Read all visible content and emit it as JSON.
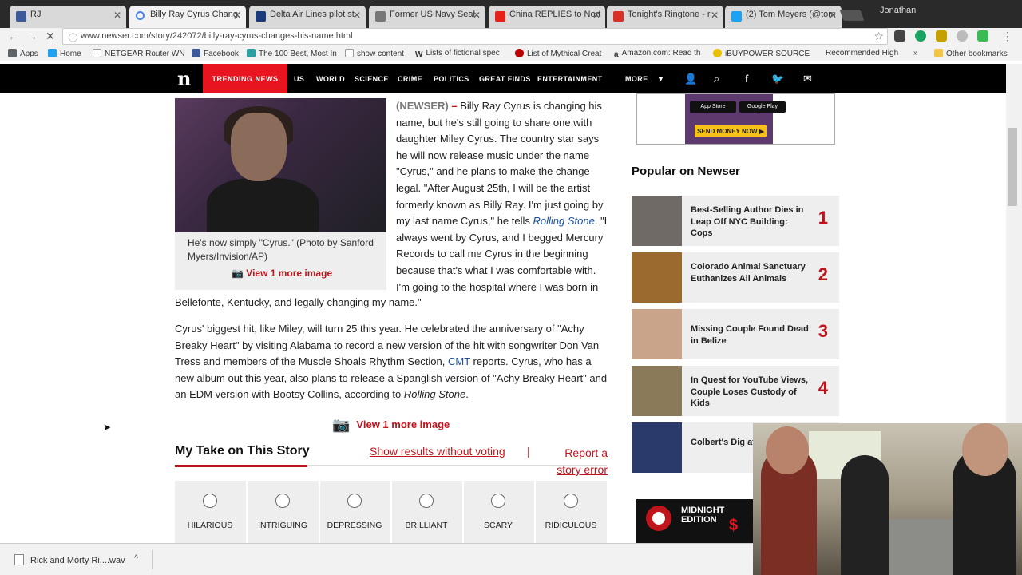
{
  "browser": {
    "tabs": [
      {
        "label": "RJ",
        "color": "#3b5998"
      },
      {
        "label": "Billy Ray Cyrus Chang",
        "color": "#4a86e8",
        "active": true
      },
      {
        "label": "Delta Air Lines pilot st",
        "color": "#1a3a7a"
      },
      {
        "label": "Former US Navy Seal ",
        "color": "#777777"
      },
      {
        "label": "China REPLIES to Nort",
        "color": "#e62117"
      },
      {
        "label": "Tonight's Ringtone - r",
        "color": "#d93025"
      },
      {
        "label": "(2) Tom Meyers (@tom",
        "color": "#1da1f2"
      }
    ],
    "user": "Jonathan",
    "url": "www.newser.com/story/242072/billy-ray-cyrus-changes-his-name.html",
    "bookmarks": [
      "Apps",
      "Home",
      "NETGEAR Router WN",
      "Facebook",
      "The 100 Best, Most In",
      "show content",
      "Lists of fictional spec",
      "List of Mythical Creat",
      "Amazon.com: Read th",
      "iBUYPOWER SOURCE",
      "Recommended High",
      "»",
      "Other bookmarks"
    ]
  },
  "site_nav": {
    "logo": "n",
    "trending": "TRENDING NEWS",
    "links": [
      "US",
      "WORLD",
      "SCIENCE",
      "CRIME",
      "POLITICS",
      "GREAT FINDS",
      "ENTERTAINMENT",
      "MORE"
    ]
  },
  "article": {
    "caption": "He's now simply \"Cyrus.\"  (Photo by Sanford Myers/Invision/AP)",
    "view_more": "View 1 more image",
    "p1_source": "(NEWSER)",
    "p1_dash": " – ",
    "p1_text_a": "Billy Ray Cyrus is changing his name, but he's still going to share one with daughter Miley Cyrus. The country star says he will now release music under the name \"Cyrus,\" and he plans to make the change legal. \"After August 25th, I will be the artist formerly known as Billy Ray. I'm just going by my last name Cyrus,\" he tells ",
    "p1_link": "Rolling Stone",
    "p1_text_b": ". \"I always went by Cyrus, and I begged Mercury Records to call me Cyrus in the beginning because that's what I was comfortable with. I'm going to the hospital where I was born in Bellefonte, Kentucky, and legally changing my name.\"",
    "p2_text_a": "Cyrus' biggest hit, like Miley, will turn 25 this year. He celebrated the anniversary of \"Achy Breaky Heart\" by visiting Alabama to record a new version of the hit with songwriter Don Van Tress and members of the Muscle Shoals Rhythm Section, ",
    "p2_link": "CMT",
    "p2_text_b": " reports. Cyrus, who has a new album out this year, also plans to release a Spanglish version of \"Achy Breaky Heart\" and an EDM version with Bootsy Collins, according to ",
    "p2_italic": "Rolling Stone",
    "p2_end": "."
  },
  "my_take": {
    "title": "My Take on This Story",
    "show_results": "Show results without voting",
    "separator": "|",
    "report": "Report a story error",
    "reactions": [
      "HILARIOUS",
      "INTRIGUING",
      "DEPRESSING",
      "BRILLIANT",
      "SCARY",
      "RIDICULOUS"
    ]
  },
  "sidebar": {
    "ad_top": {
      "app_store": "App Store",
      "google_play": "Google Play",
      "button": "SEND MONEY NOW ▶"
    },
    "popular_title": "Popular on Newser",
    "popular": [
      {
        "title": "Best-Selling Author Dies in Leap Off NYC Building: Cops",
        "num": "1",
        "thumb": "#6f6a66"
      },
      {
        "title": "Colorado Animal Sanctuary Euthanizes All Animals",
        "num": "2",
        "thumb": "#9a6a2e"
      },
      {
        "title": "Missing Couple Found Dead in Belize",
        "num": "3",
        "thumb": "#c9a48a"
      },
      {
        "title": "In Quest for YouTube Views, Couple Loses Custody of Kids",
        "num": "4",
        "thumb": "#8a7a5a"
      },
      {
        "title": "Colbert's Dig at ... Called 'Homop...",
        "num": "5",
        "thumb": "#2a3a6a"
      }
    ],
    "ad_bottom": {
      "text": "MIDNIGHT EDITION",
      "symbol": "$"
    }
  },
  "downloads": {
    "item": "Rick and Morty Ri....wav",
    "caret": "^"
  }
}
